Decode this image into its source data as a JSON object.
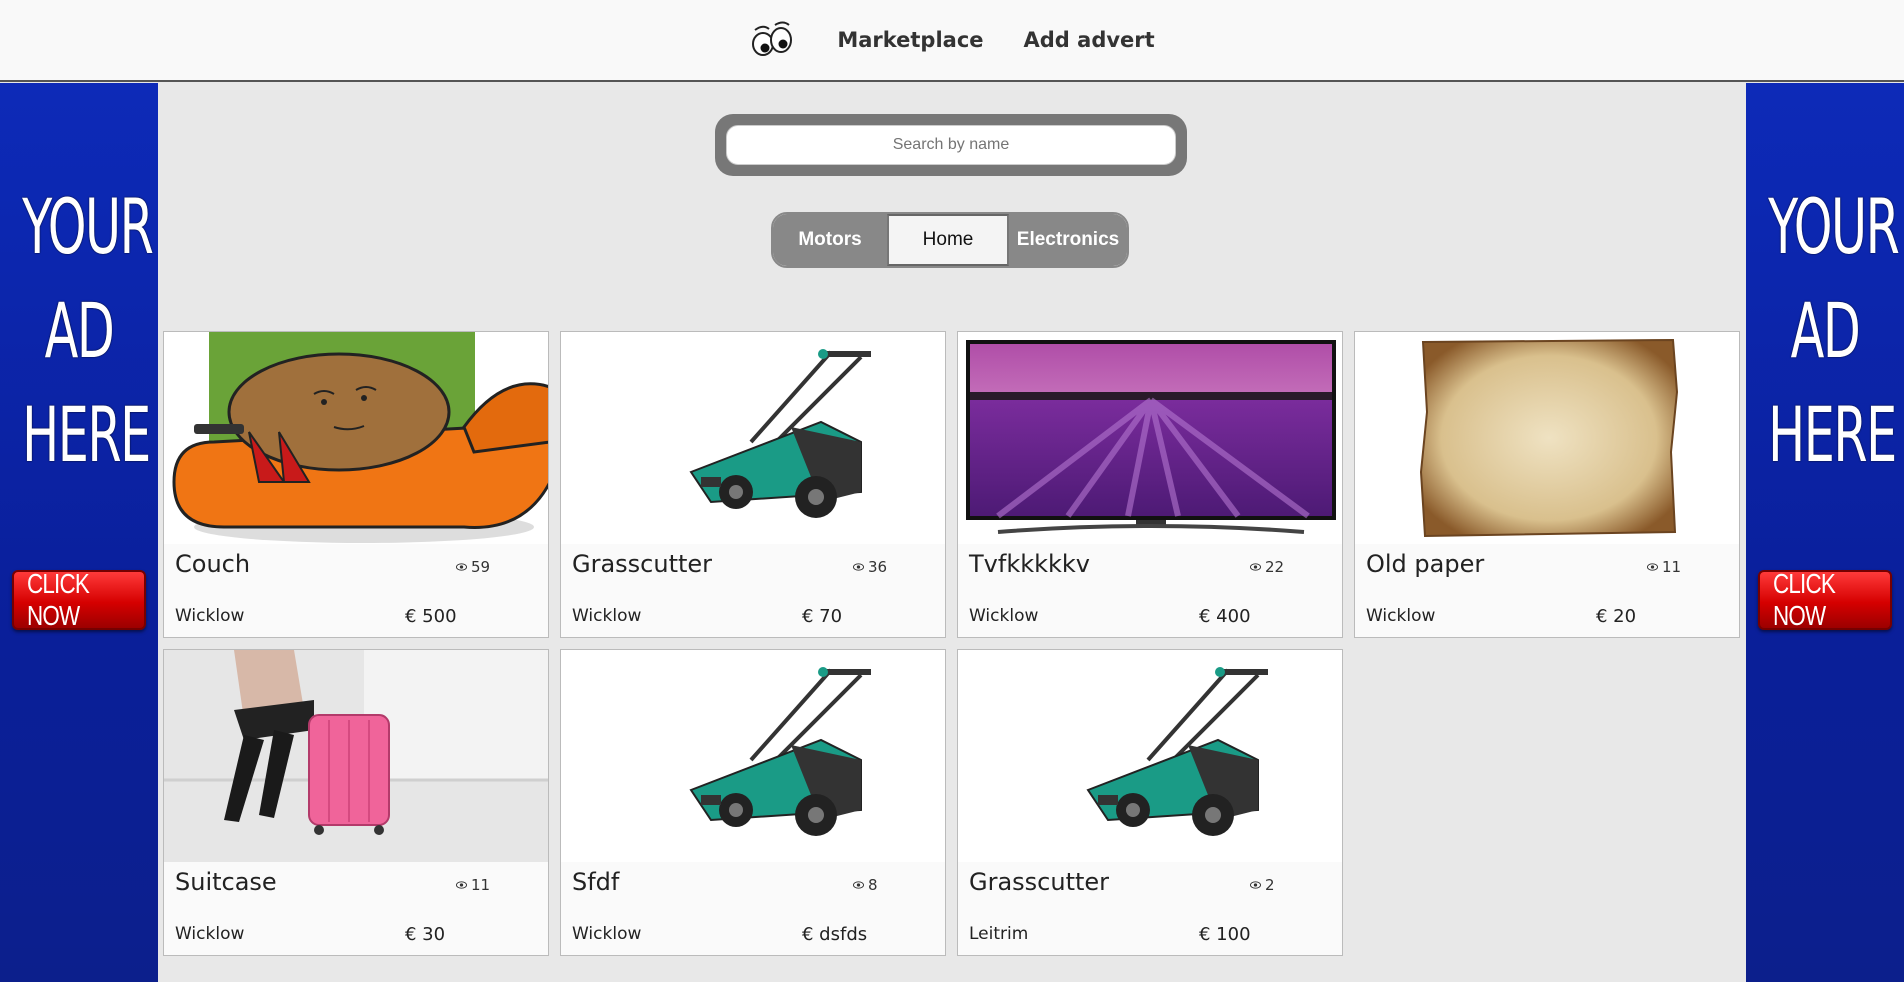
{
  "nav": {
    "logo_icon": "eyes-logo-icon",
    "marketplace_label": "Marketplace",
    "add_advert_label": "Add advert"
  },
  "ads": {
    "text_line1": "YOUR",
    "text_line2": "AD",
    "text_line3": "HERE",
    "cta": "CLICK NOW",
    "colors": {
      "panel": "#0d2ab8",
      "cta": "#d50000"
    }
  },
  "search": {
    "placeholder": "Search by name",
    "value": ""
  },
  "categories": [
    {
      "label": "Motors",
      "active": false
    },
    {
      "label": "Home",
      "active": true
    },
    {
      "label": "Electronics",
      "active": false
    }
  ],
  "listings": [
    {
      "title": "Couch",
      "views": "59",
      "location": "Wicklow",
      "price": "€ 500",
      "image": "couch-potato-image"
    },
    {
      "title": "Grasscutter",
      "views": "36",
      "location": "Wicklow",
      "price": "€ 70",
      "image": "lawnmower-image"
    },
    {
      "title": "Tvfkkkkkv",
      "views": "22",
      "location": "Wicklow",
      "price": "€ 400",
      "image": "tv-lavender-image"
    },
    {
      "title": "Old paper",
      "views": "11",
      "location": "Wicklow",
      "price": "€ 20",
      "image": "old-paper-image"
    },
    {
      "title": "Suitcase",
      "views": "11",
      "location": "Wicklow",
      "price": "€ 30",
      "image": "suitcase-image"
    },
    {
      "title": "Sfdf",
      "views": "8",
      "location": "Wicklow",
      "price": "€ dsfds",
      "image": "lawnmower-image"
    },
    {
      "title": "Grasscutter",
      "views": "2",
      "location": "Leitrim",
      "price": "€ 100",
      "image": "lawnmower-image"
    }
  ]
}
